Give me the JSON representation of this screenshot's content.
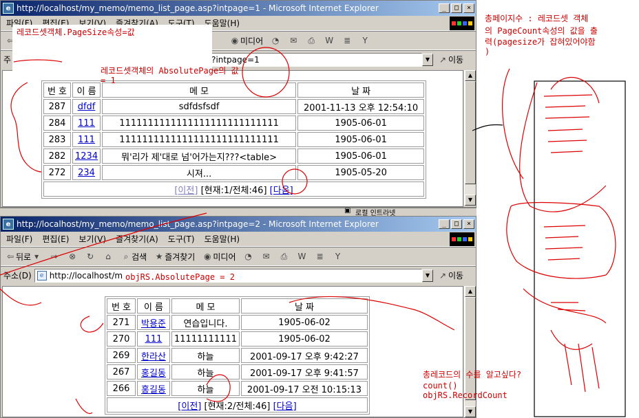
{
  "window1": {
    "title": "http://localhost/my_memo/memo_list_page.asp?intpage=1 - Microsoft Internet Explorer",
    "menu": [
      "파일(F)",
      "편집(E)",
      "보기(V)",
      "즐겨찾기(A)",
      "도구(T)",
      "도움말(H)"
    ],
    "toolbar": [
      "미디어"
    ],
    "address_tail": "ge.asp?intpage=1",
    "go_label": "이동",
    "table": {
      "headers": [
        "번 호",
        "이 름",
        "메   모",
        "날 짜"
      ],
      "rows": [
        [
          "287",
          "dfdf",
          "sdfdsfsdf",
          "2001-11-13 오후 12:54:10"
        ],
        [
          "284",
          "111",
          "1111111111111111111111111111",
          "1905-06-01"
        ],
        [
          "283",
          "111",
          "1111111111111111111111111111",
          "1905-06-01"
        ],
        [
          "282",
          "1234",
          "뭐'리가 제'대로 넘'어가는지???<table>",
          "1905-06-01"
        ],
        [
          "272",
          "234",
          "시져...",
          "1905-05-20"
        ]
      ],
      "pager": {
        "prev": "[이전]",
        "status": "[현재:1/전체:46]",
        "next": "[다음]"
      }
    },
    "status_text": "로컬 인트라넷"
  },
  "window2": {
    "title": "http://localhost/my_memo/memo_list_page.asp?intpage=2 - Microsoft Internet Explorer",
    "menu": [
      "파일(F)",
      "편집(E)",
      "보기(V)",
      "즐겨찾기(A)",
      "도구(T)",
      "도움말(H)"
    ],
    "toolbar": [
      "뒤로",
      "검색",
      "즐겨찾기",
      "미디어"
    ],
    "address_label": "주소(D)",
    "address_value": "http://localhost/m",
    "go_label": "이동",
    "table": {
      "headers": [
        "번 호",
        "이 름",
        "메  모",
        "날 짜"
      ],
      "rows": [
        [
          "271",
          "박용준",
          "연습입니다.",
          "1905-06-02"
        ],
        [
          "270",
          "111",
          "11111111111",
          "1905-06-02"
        ],
        [
          "269",
          "한라산",
          "하늘",
          "2001-09-17 오후 9:42:27"
        ],
        [
          "267",
          "홍길동",
          "하늘",
          "2001-09-17 오후 9:41:57"
        ],
        [
          "266",
          "홍길동",
          "하늘",
          "2001-09-17 오전 10:15:13"
        ]
      ],
      "pager": {
        "prev": "[이전]",
        "status": "[현재:2/전체:46]",
        "next": "[다음]"
      }
    }
  },
  "annotations": {
    "pagesize": "레코드셋객체.PageSize속성=값",
    "absolutepage_1": "레코드셋객체의 AbsolutePage의 값",
    "absolutepage_1b": "= 1",
    "absolutepage_2": "objRS.AbsolutePage = 2",
    "pagecount_1": "총페이지수 : 레코드셋 객체",
    "pagecount_2": "의 PageCount속성의 값을 출",
    "pagecount_3": "력(pagesize가 잡혀있어야함",
    "pagecount_4": ")",
    "recordcount_1": "총레코드의 수를 알고싶다?",
    "recordcount_2": "count()",
    "recordcount_3": "objRS.RecordCount"
  },
  "colors": {
    "title_start": "#0a246a",
    "title_end": "#a6caf0",
    "chrome": "#d4d0c8",
    "annotation": "#cc0000",
    "link": "#0000cc"
  }
}
